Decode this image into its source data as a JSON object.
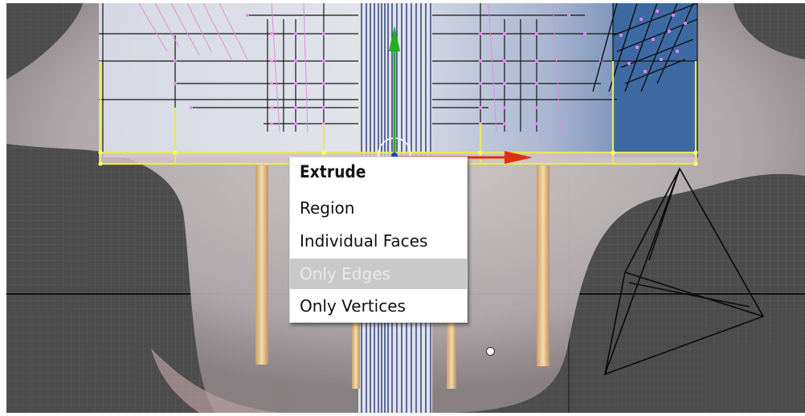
{
  "extrude_menu": {
    "title": "Extrude",
    "items": [
      {
        "label": "Region",
        "enabled": true
      },
      {
        "label": "Individual Faces",
        "enabled": true
      },
      {
        "label": "Only Edges",
        "enabled": false
      },
      {
        "label": "Only Vertices",
        "enabled": true
      }
    ]
  },
  "colors": {
    "viewport_background": "#4c4c4c",
    "selected_edge": "#e8e85a",
    "vertex": "#ff80ff",
    "axis_x": "#e03010",
    "axis_y": "#20b020",
    "axis_z": "#2040d0",
    "menu_background": "#ffffff",
    "menu_disabled_background": "#c9c9c9",
    "menu_disabled_text": "#e9e9e9"
  }
}
